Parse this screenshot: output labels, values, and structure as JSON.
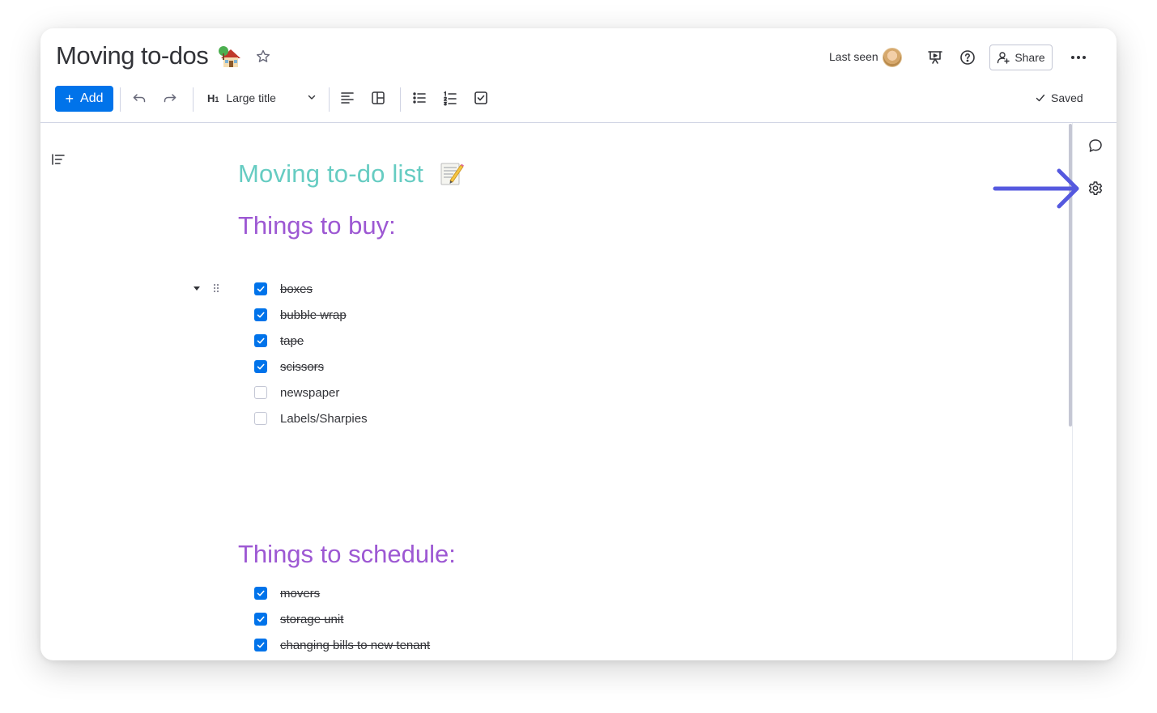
{
  "header": {
    "title": "Moving to-dos",
    "title_emoji": "house-with-tree-emoji",
    "last_seen_label": "Last seen",
    "share_label": "Share"
  },
  "toolbar": {
    "add_label": "Add",
    "heading_prefix": "H",
    "heading_sub": "1",
    "heading_value": "Large title",
    "saved_label": "Saved"
  },
  "document": {
    "main_heading": "Moving to-do list",
    "main_heading_emoji": "memo-emoji",
    "sections": [
      {
        "heading": "Things to buy:",
        "items": [
          {
            "text": "boxes",
            "checked": true
          },
          {
            "text": "bubble wrap",
            "checked": true
          },
          {
            "text": "tape",
            "checked": true
          },
          {
            "text": "scissors",
            "checked": true
          },
          {
            "text": "newspaper",
            "checked": false
          },
          {
            "text": "Labels/Sharpies",
            "checked": false
          }
        ]
      },
      {
        "heading": "Things to schedule:",
        "items": [
          {
            "text": "movers",
            "checked": true
          },
          {
            "text": "storage unit",
            "checked": true
          },
          {
            "text": "changing bills to new tenant",
            "checked": true
          }
        ]
      }
    ]
  },
  "colors": {
    "accent": "#0073ea",
    "main_heading": "#66ccc2",
    "section_heading": "#9d58d3",
    "annotation_arrow": "#5559df"
  }
}
